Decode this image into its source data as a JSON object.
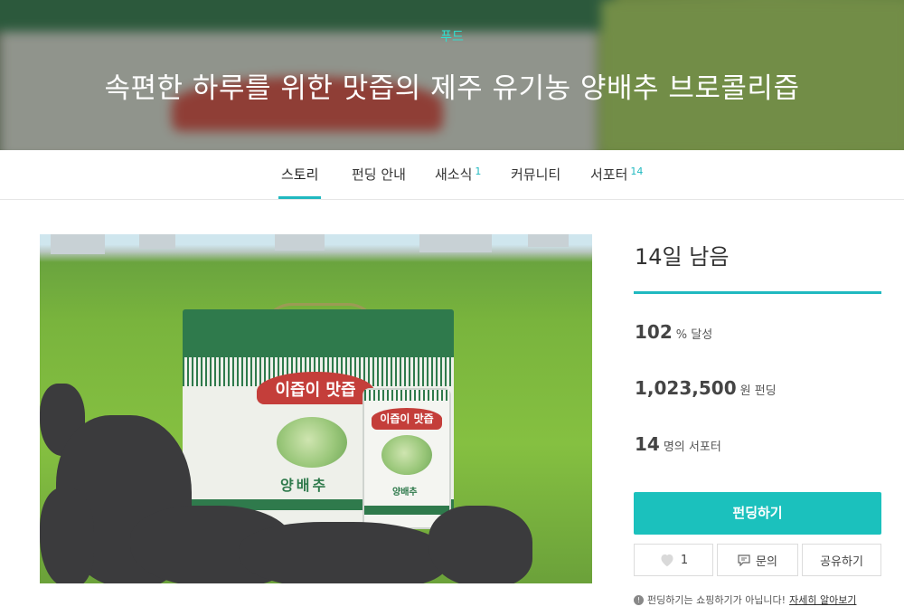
{
  "hero": {
    "category": "푸드",
    "title": "속편한 하루를 위한 맛즙의 제주 유기농 양배추 브로콜리즙"
  },
  "tabs": [
    {
      "label": "스토리",
      "badge": ""
    },
    {
      "label": "펀딩 안내",
      "badge": ""
    },
    {
      "label": "새소식",
      "badge": "1"
    },
    {
      "label": "커뮤니티",
      "badge": ""
    },
    {
      "label": "서포터",
      "badge": "14"
    }
  ],
  "product_image": {
    "box_label": "이즙이 맛즙",
    "box_name": "양배추",
    "pouch_label": "이즙이 맛즙",
    "pouch_name": "양배추"
  },
  "sidebar": {
    "remaining": "14일 남음",
    "progress_fraction": 1.0,
    "achievement": {
      "value": "102",
      "unit": "% 달성"
    },
    "funded": {
      "value": "1,023,500",
      "unit": "원 펀딩"
    },
    "supporters": {
      "value": "14",
      "unit": "명의 서포터"
    },
    "fund_button": "펀딩하기",
    "like_count": "1",
    "inquiry_button": "문의",
    "share_button": "공유하기",
    "notice_text": "펀딩하기는 쇼핑하기가 아닙니다!",
    "notice_link": "자세히 알아보기"
  },
  "colors": {
    "accent": "#1bc1bd",
    "category": "#2ee0d1"
  }
}
